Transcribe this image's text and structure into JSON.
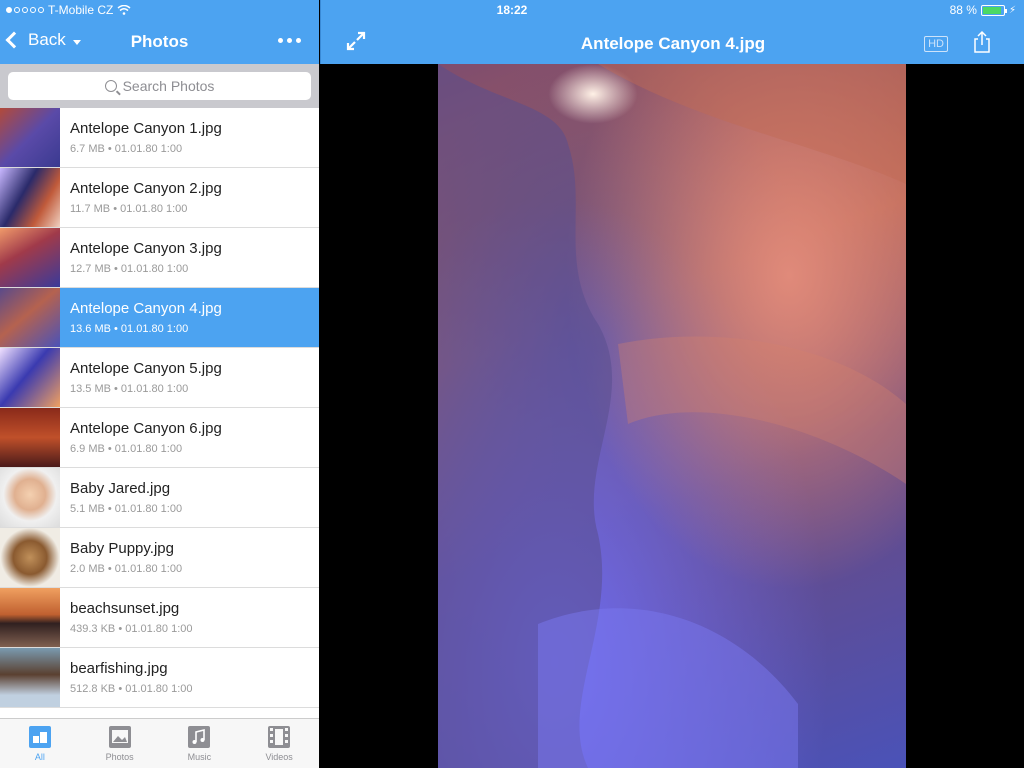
{
  "status": {
    "carrier": "T-Mobile CZ",
    "time": "18:22",
    "battery": "88 %",
    "battery_level": 0.88
  },
  "sidebar": {
    "back_label": "Back",
    "title": "Photos",
    "search_placeholder": "Search Photos",
    "files": [
      {
        "name": "Antelope Canyon 1.jpg",
        "meta": "6.7 MB  •  01.01.80 1:00"
      },
      {
        "name": "Antelope Canyon 2.jpg",
        "meta": "11.7 MB  •  01.01.80 1:00"
      },
      {
        "name": "Antelope Canyon 3.jpg",
        "meta": "12.7 MB  •  01.01.80 1:00"
      },
      {
        "name": "Antelope Canyon 4.jpg",
        "meta": "13.6 MB  •  01.01.80 1:00"
      },
      {
        "name": "Antelope Canyon 5.jpg",
        "meta": "13.5 MB  •  01.01.80 1:00"
      },
      {
        "name": "Antelope Canyon 6.jpg",
        "meta": "6.9 MB  •  01.01.80 1:00"
      },
      {
        "name": "Baby Jared.jpg",
        "meta": "5.1 MB  •  01.01.80 1:00"
      },
      {
        "name": "Baby Puppy.jpg",
        "meta": "2.0 MB  •  01.01.80 1:00"
      },
      {
        "name": "beachsunset.jpg",
        "meta": "439.3 KB  •  01.01.80 1:00"
      },
      {
        "name": "bearfishing.jpg",
        "meta": "512.8 KB  •  01.01.80 1:00"
      }
    ],
    "tabs": [
      {
        "label": "All",
        "icon": "all-icon"
      },
      {
        "label": "Photos",
        "icon": "photos-icon"
      },
      {
        "label": "Music",
        "icon": "music-icon"
      },
      {
        "label": "Videos",
        "icon": "videos-icon"
      }
    ]
  },
  "viewer": {
    "title": "Antelope Canyon 4.jpg",
    "hd_label": "HD"
  },
  "colors": {
    "accent": "#4ca3f1",
    "selected_row": "#4ca3f1",
    "battery": "#4cd964"
  }
}
